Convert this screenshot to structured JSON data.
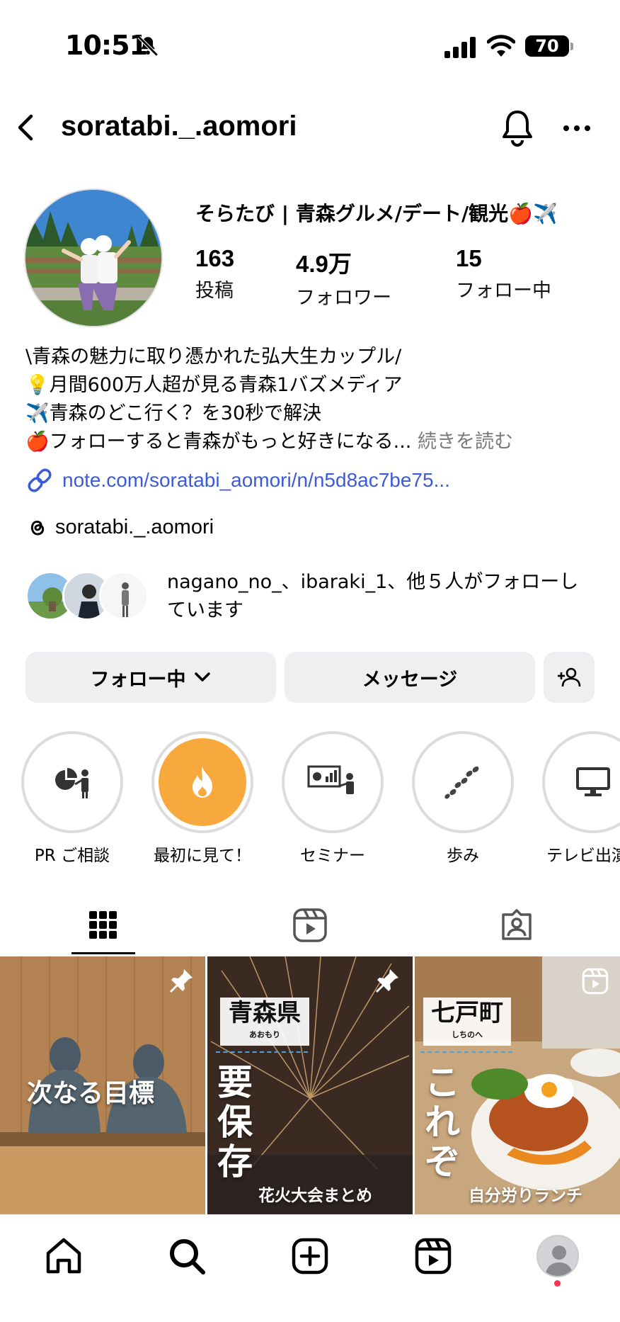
{
  "status_bar": {
    "time": "10:51",
    "battery": "70"
  },
  "header": {
    "username": "soratabi._.aomori"
  },
  "profile": {
    "display_name": "そらたび | 青森グルメ/デート/観光🍎✈️",
    "stats": [
      {
        "value": "163",
        "label": "投稿"
      },
      {
        "value": "4.9万",
        "label": "フォロワー"
      },
      {
        "value": "15",
        "label": "フォロー中"
      }
    ],
    "bio_lines": [
      "\\青森の魅力に取り憑かれた弘大生カップル/",
      "💡月間600万人超が見る青森1バズメディア",
      "✈️青森のどこ行く？を30秒で解決",
      "🍎フォローすると青森がもっと好きになる..."
    ],
    "bio_more": "続きを読む",
    "link": "note.com/soratabi_aomori/n/n5d8ac7be75...",
    "threads_handle": "soratabi._.aomori",
    "followed_by": "nagano_no_、ibaraki_1、他５人がフォローしています"
  },
  "actions": {
    "following": "フォロー中",
    "message": "メッセージ"
  },
  "highlights": [
    {
      "label": "PR ご相談",
      "icon": "pie-chart-presenter-icon"
    },
    {
      "label": "最初に見て！",
      "icon": "fire-icon"
    },
    {
      "label": "セミナー",
      "icon": "presentation-icon"
    },
    {
      "label": "歩み",
      "icon": "footprints-icon"
    },
    {
      "label": "テレビ出演",
      "icon": "monitor-icon"
    }
  ],
  "posts": [
    {
      "text": "次なる目標",
      "pinned": true
    },
    {
      "place": "青森県",
      "place_kana": "あおもり",
      "big": "要保存",
      "sub": "花火大会まとめ",
      "pinned": true
    },
    {
      "place": "七戸町",
      "place_kana": "しちのへ",
      "big": "これぞ",
      "sub": "自分労りランチ",
      "reel": true
    }
  ],
  "colors": {
    "link": "#3b5bdb",
    "highlight_orange": "#f7a93e",
    "notification_dot": "#ff2e4a"
  }
}
